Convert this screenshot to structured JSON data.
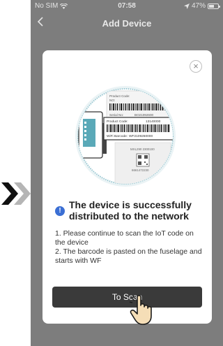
{
  "status_bar": {
    "carrier": "No SIM",
    "time": "07:58",
    "battery_percent": "47%"
  },
  "header": {
    "back_icon": "chevron-left-icon",
    "title": "Add Device"
  },
  "dialog": {
    "close_icon": "close-icon",
    "illustration": {
      "back_label_product_code": "Product Code:",
      "back_label_no": "NO:",
      "back_label_serial": "Serial No:",
      "back_serial_value": "BO21092600",
      "front_label_product_code": "Product Code:",
      "front_product_code_value": "13140000",
      "front_label_wifi_barcode": "WiFi Barcode:",
      "front_wifi_barcode_value": "WF2109260000",
      "lower_label_model": "MXL290 2300100",
      "lower_label_code": "6661472230"
    },
    "headline": "The device is successfully distributed to the network",
    "description_line1": "1. Please continue to scan the IoT code on the device",
    "description_line2": "2. The barcode is pasted on the fuselage and starts with WF",
    "scan_button_label": "To Scan"
  },
  "colors": {
    "overlay": "#7d7d7d",
    "button": "#3a3a3a",
    "info_icon": "#3b6fd4",
    "illustration_teal": "#5aa9b8"
  }
}
